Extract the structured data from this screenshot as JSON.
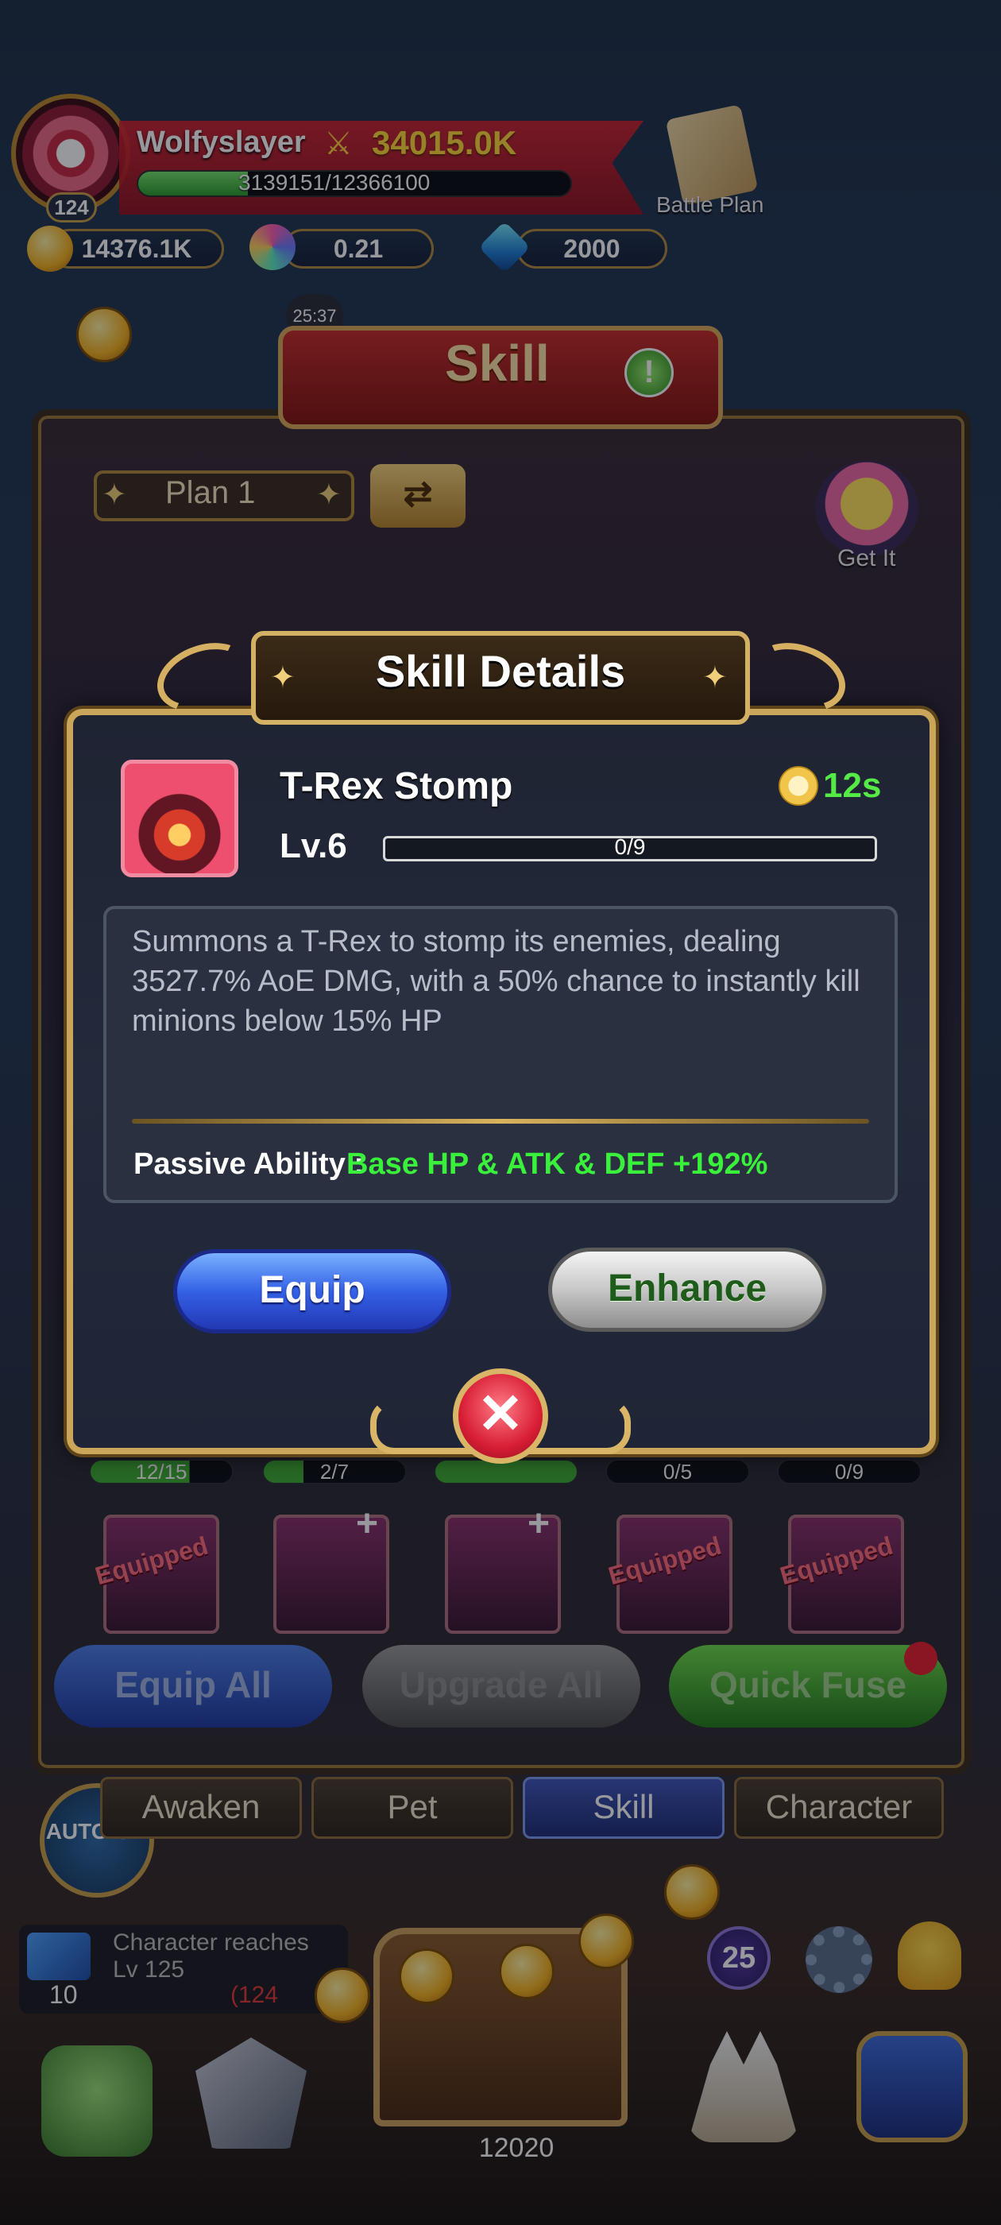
{
  "hud": {
    "player_name": "Wolfyslayer",
    "combat_power": "34015.0K",
    "exp_text": "3139151/12366100",
    "exp_progress": 0.254,
    "player_level": "124",
    "battle_plan_label": "Battle Plan",
    "resources": [
      {
        "name": "gold",
        "value": "14376.1K"
      },
      {
        "name": "stars",
        "value": "0.21"
      },
      {
        "name": "gems",
        "value": "2000"
      }
    ],
    "timer": "25:37"
  },
  "skill_screen": {
    "title": "Skill",
    "plan_label": "Plan 1",
    "get_it_label": "Get It",
    "skill_bars": [
      "12/15",
      "2/7",
      "",
      "0/5",
      "0/9"
    ],
    "slot_tags": [
      "Equipped",
      "",
      "",
      "Equipped",
      "Equipped"
    ],
    "footer": {
      "equip_all": "Equip All",
      "upgrade_all": "Upgrade All",
      "quick_fuse": "Quick Fuse"
    }
  },
  "modal": {
    "title": "Skill Details",
    "skill_name": "T-Rex Stomp",
    "cooldown": "12s",
    "level": "Lv.6",
    "level_progress": "0/9",
    "description": "Summons a T-Rex to stomp its enemies, dealing 3527.7% AoE DMG, with a 50% chance to instantly kill minions below 15% HP",
    "passive_label": "Passive Ability :",
    "passive_value": "Base HP & ATK & DEF +192%",
    "equip_label": "Equip",
    "enhance_label": "Enhance",
    "close_glyph": "✕"
  },
  "bottom_nav": {
    "tabs": [
      "Awaken",
      "Pet",
      "Skill",
      "Character"
    ],
    "auto_label": "AUTO ON",
    "quest": {
      "text": "Character reaches Lv 125",
      "progress": "(124",
      "count": "10"
    },
    "level_orb": "25",
    "chest_count": "12020"
  },
  "icons": {
    "sword": "⚔",
    "swap": "⇄",
    "star": "✦",
    "plus": "+",
    "alert": "!"
  },
  "colors": {
    "cooldown_green": "#55ea45",
    "passive_green": "#39f03b",
    "equip_blue": "#3461e6",
    "frame_gold": "#c9a659"
  }
}
